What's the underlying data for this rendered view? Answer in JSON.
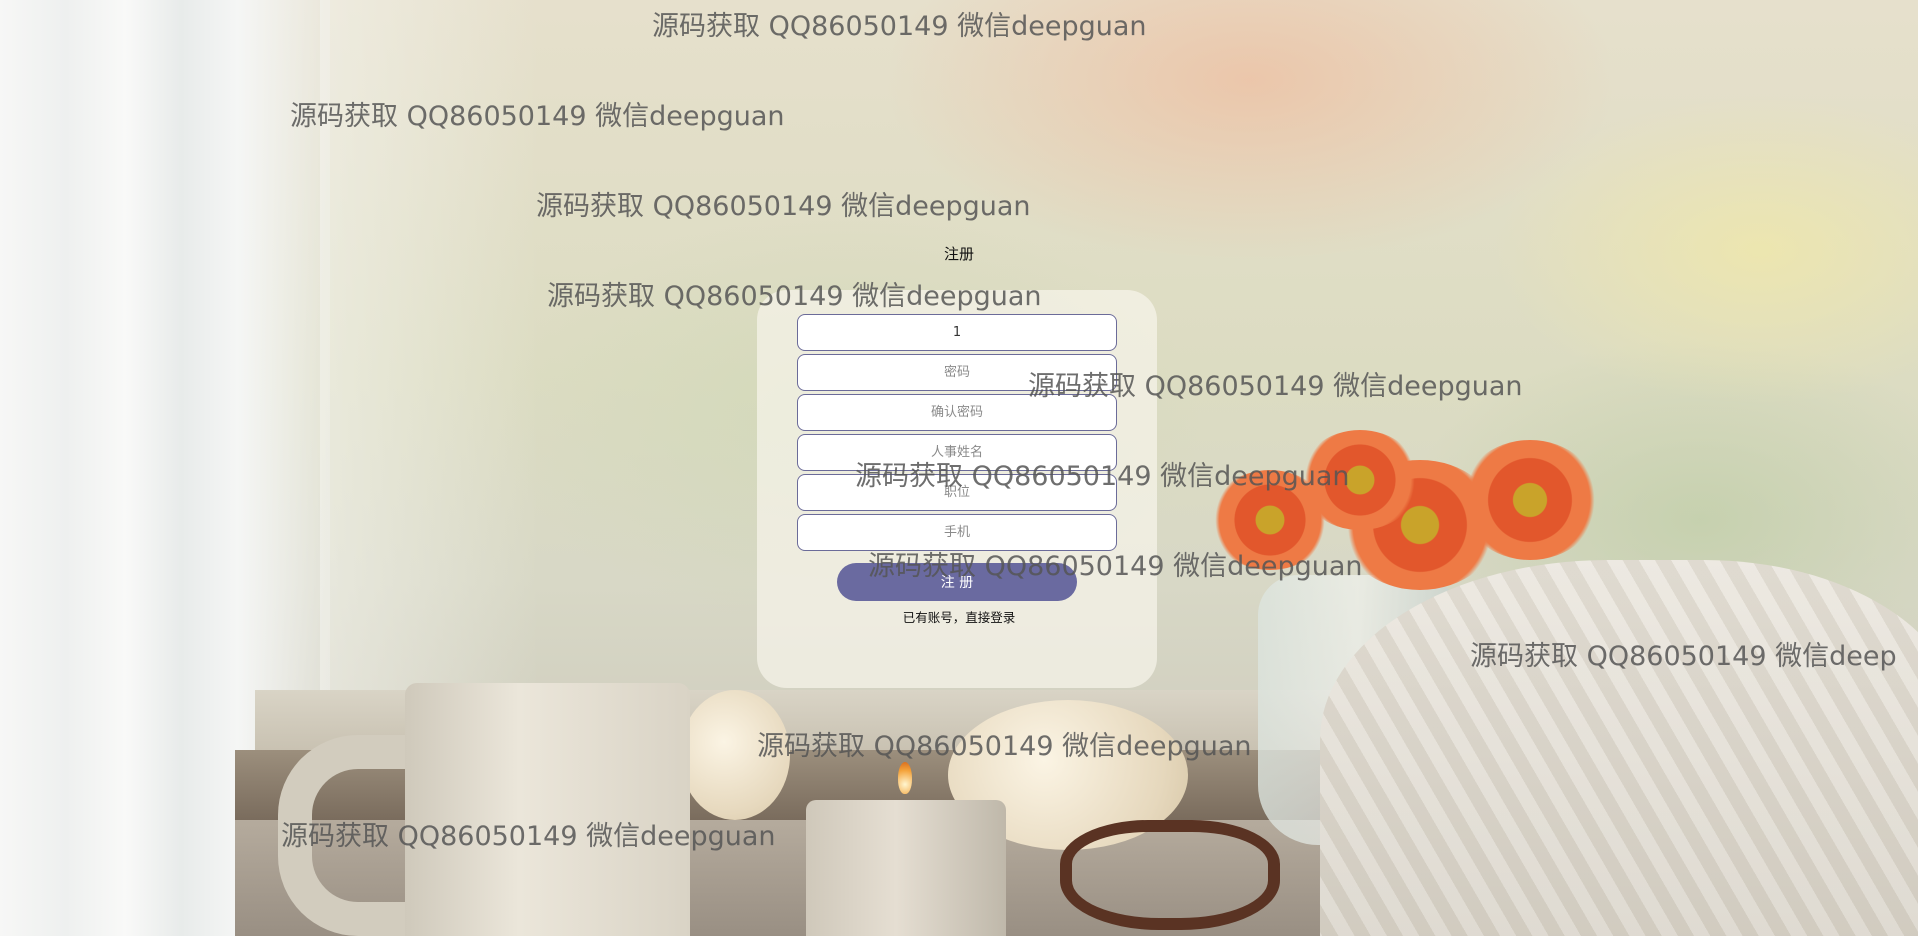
{
  "form": {
    "title": "注册",
    "fields": [
      {
        "name": "username",
        "value": "1",
        "placeholder": ""
      },
      {
        "name": "password",
        "value": "",
        "placeholder": "密码"
      },
      {
        "name": "confirm_password",
        "value": "",
        "placeholder": "确认密码"
      },
      {
        "name": "hr_name",
        "value": "",
        "placeholder": "人事姓名"
      },
      {
        "name": "position",
        "value": "",
        "placeholder": "职位"
      },
      {
        "name": "phone",
        "value": "",
        "placeholder": "手机"
      }
    ],
    "submit_label": "注 册",
    "login_link": "已有账号，直接登录"
  },
  "watermarks": [
    "源码获取 QQ86050149 微信deepguan",
    "源码获取 QQ86050149 微信deepguan",
    "源码获取 QQ86050149 微信deepguan",
    "源码获取 QQ86050149 微信deepguan",
    "源码获取 QQ86050149 微信deepguan",
    "源码获取 QQ86050149 微信deepguan",
    "源码获取 QQ86050149 微信deepguan",
    "源码获取 QQ86050149 微信deep",
    "源码获取 QQ86050149 微信deepguan",
    "源码获取 QQ86050149 微信deepguan"
  ]
}
